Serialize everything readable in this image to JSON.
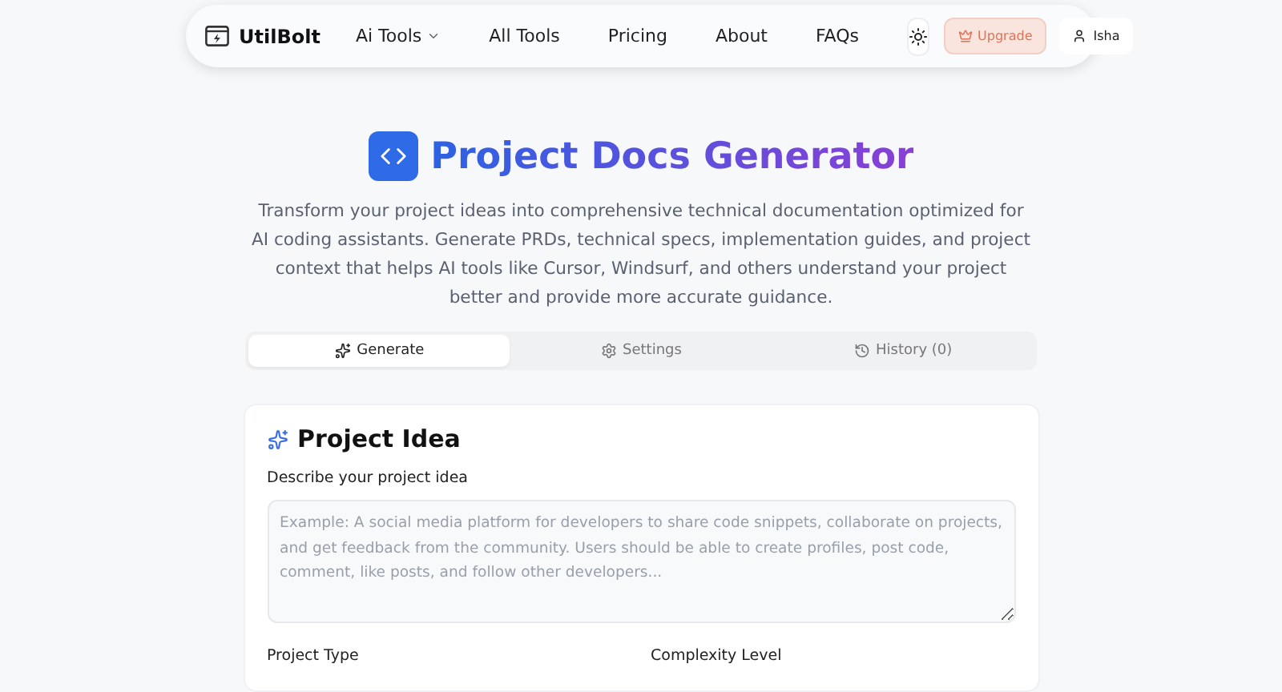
{
  "nav": {
    "brand": "UtilBolt",
    "items": [
      {
        "label": "Ai Tools",
        "dropdown": true
      },
      {
        "label": "All Tools",
        "dropdown": false
      },
      {
        "label": "Pricing",
        "dropdown": false
      },
      {
        "label": "About",
        "dropdown": false
      },
      {
        "label": "FAQs",
        "dropdown": false
      }
    ],
    "upgrade": "Upgrade",
    "user": "Isha"
  },
  "hero": {
    "title": "Project Docs Generator",
    "description": "Transform your project ideas into comprehensive technical documentation optimized for AI coding assistants. Generate PRDs, technical specs, implementation guides, and project context that helps AI tools like Cursor, Windsurf, and others understand your project better and provide more accurate guidance."
  },
  "tabs": [
    {
      "label": "Generate",
      "kind": "generate",
      "selected": true
    },
    {
      "label": "Settings",
      "kind": "settings",
      "selected": false
    },
    {
      "label": "History (0)",
      "kind": "history",
      "selected": false
    }
  ],
  "card": {
    "title": "Project Idea",
    "field_label": "Describe your project idea",
    "placeholder": "Example: A social media platform for developers to share code snippets, collaborate on projects, and get feedback from the community. Users should be able to create profiles, post code, comment, like posts, and follow other developers...",
    "labels": [
      "Project Type",
      "Complexity Level"
    ]
  }
}
